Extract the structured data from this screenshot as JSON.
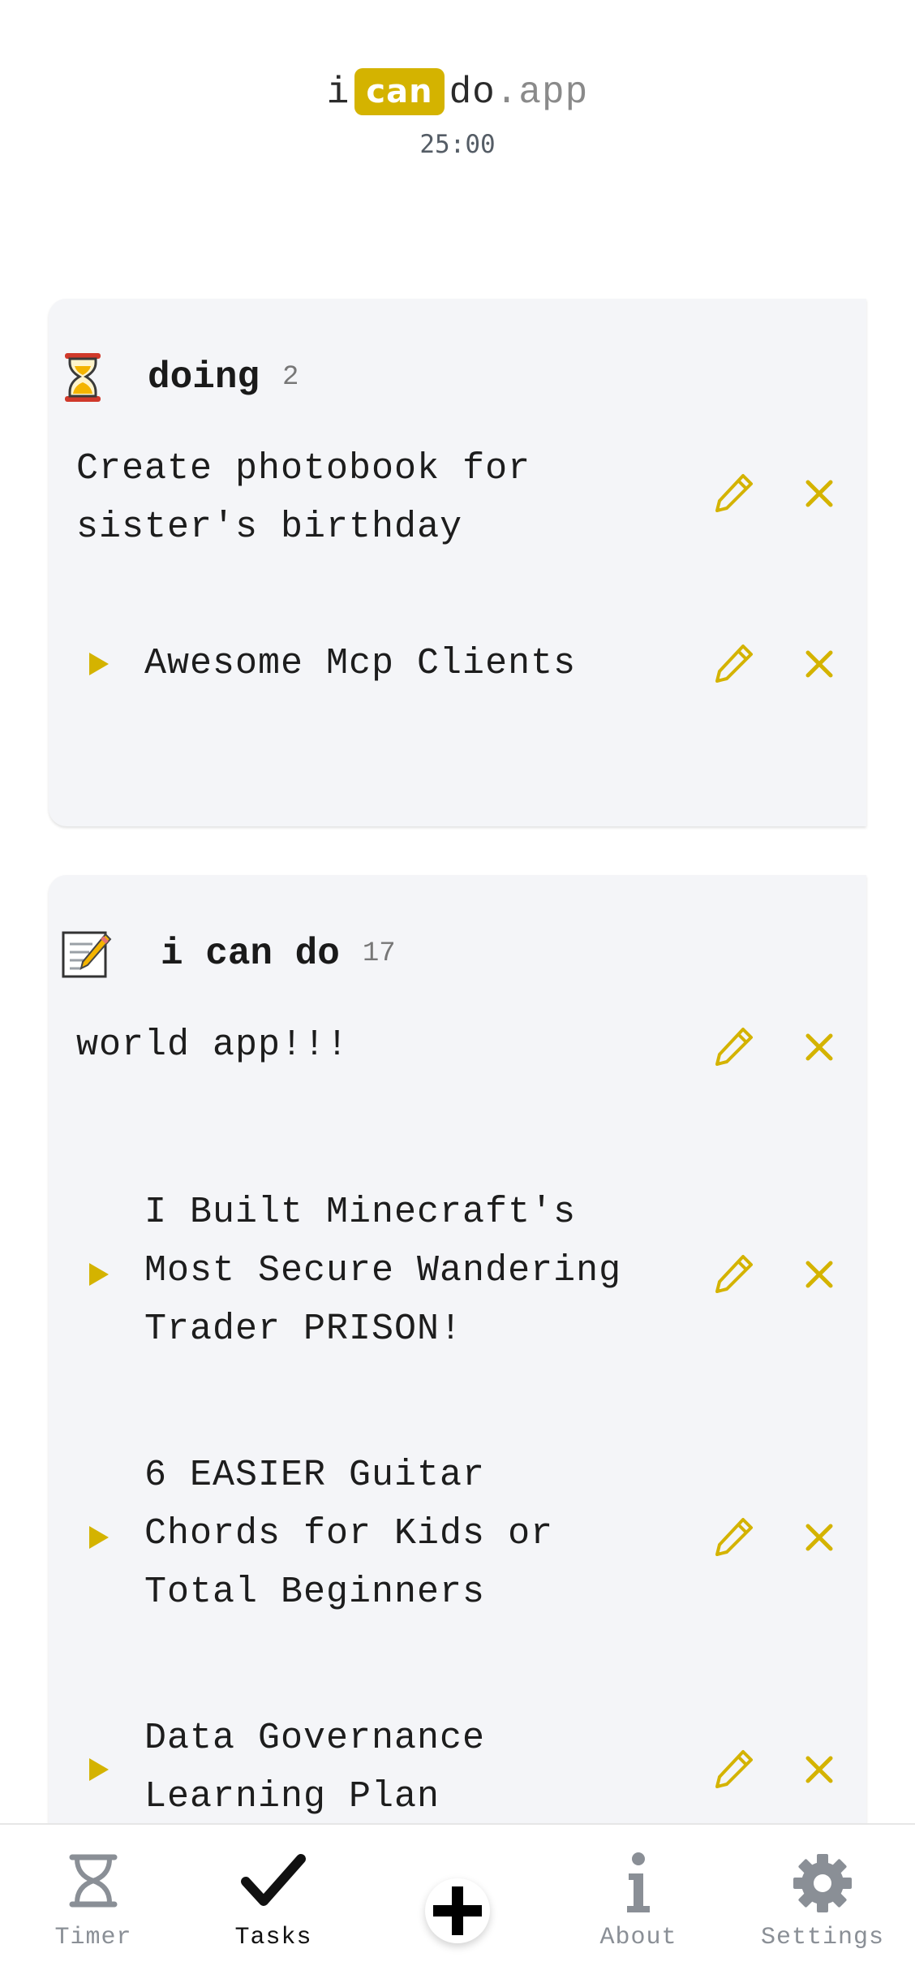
{
  "brand": {
    "part_i": "i",
    "part_can": "can",
    "part_do": "do",
    "part_app": ".app"
  },
  "timer": {
    "readout": "25:00"
  },
  "accent_color": "#d4b300",
  "lists": [
    {
      "title": "doing",
      "count": "2",
      "icon": "hourglass-icon",
      "tasks": [
        {
          "text": "Create photobook for\nsister's birthday",
          "has_play": false
        },
        {
          "text": "Awesome Mcp Clients",
          "has_play": true
        }
      ]
    },
    {
      "title": "i can do",
      "count": "17",
      "icon": "memo-icon",
      "tasks": [
        {
          "text": "world app!!!",
          "has_play": false
        },
        {
          "text": "I Built Minecraft's\nMost Secure Wandering\nTrader PRISON!",
          "has_play": true
        },
        {
          "text": "6 EASIER Guitar\nChords for Kids or\nTotal Beginners",
          "has_play": true
        },
        {
          "text": "Data Governance\nLearning Plan",
          "has_play": true
        }
      ]
    }
  ],
  "nav": {
    "timer": "Timer",
    "tasks": "Tasks",
    "add": "add-icon",
    "about": "About",
    "settings": "Settings",
    "active": "tasks"
  }
}
